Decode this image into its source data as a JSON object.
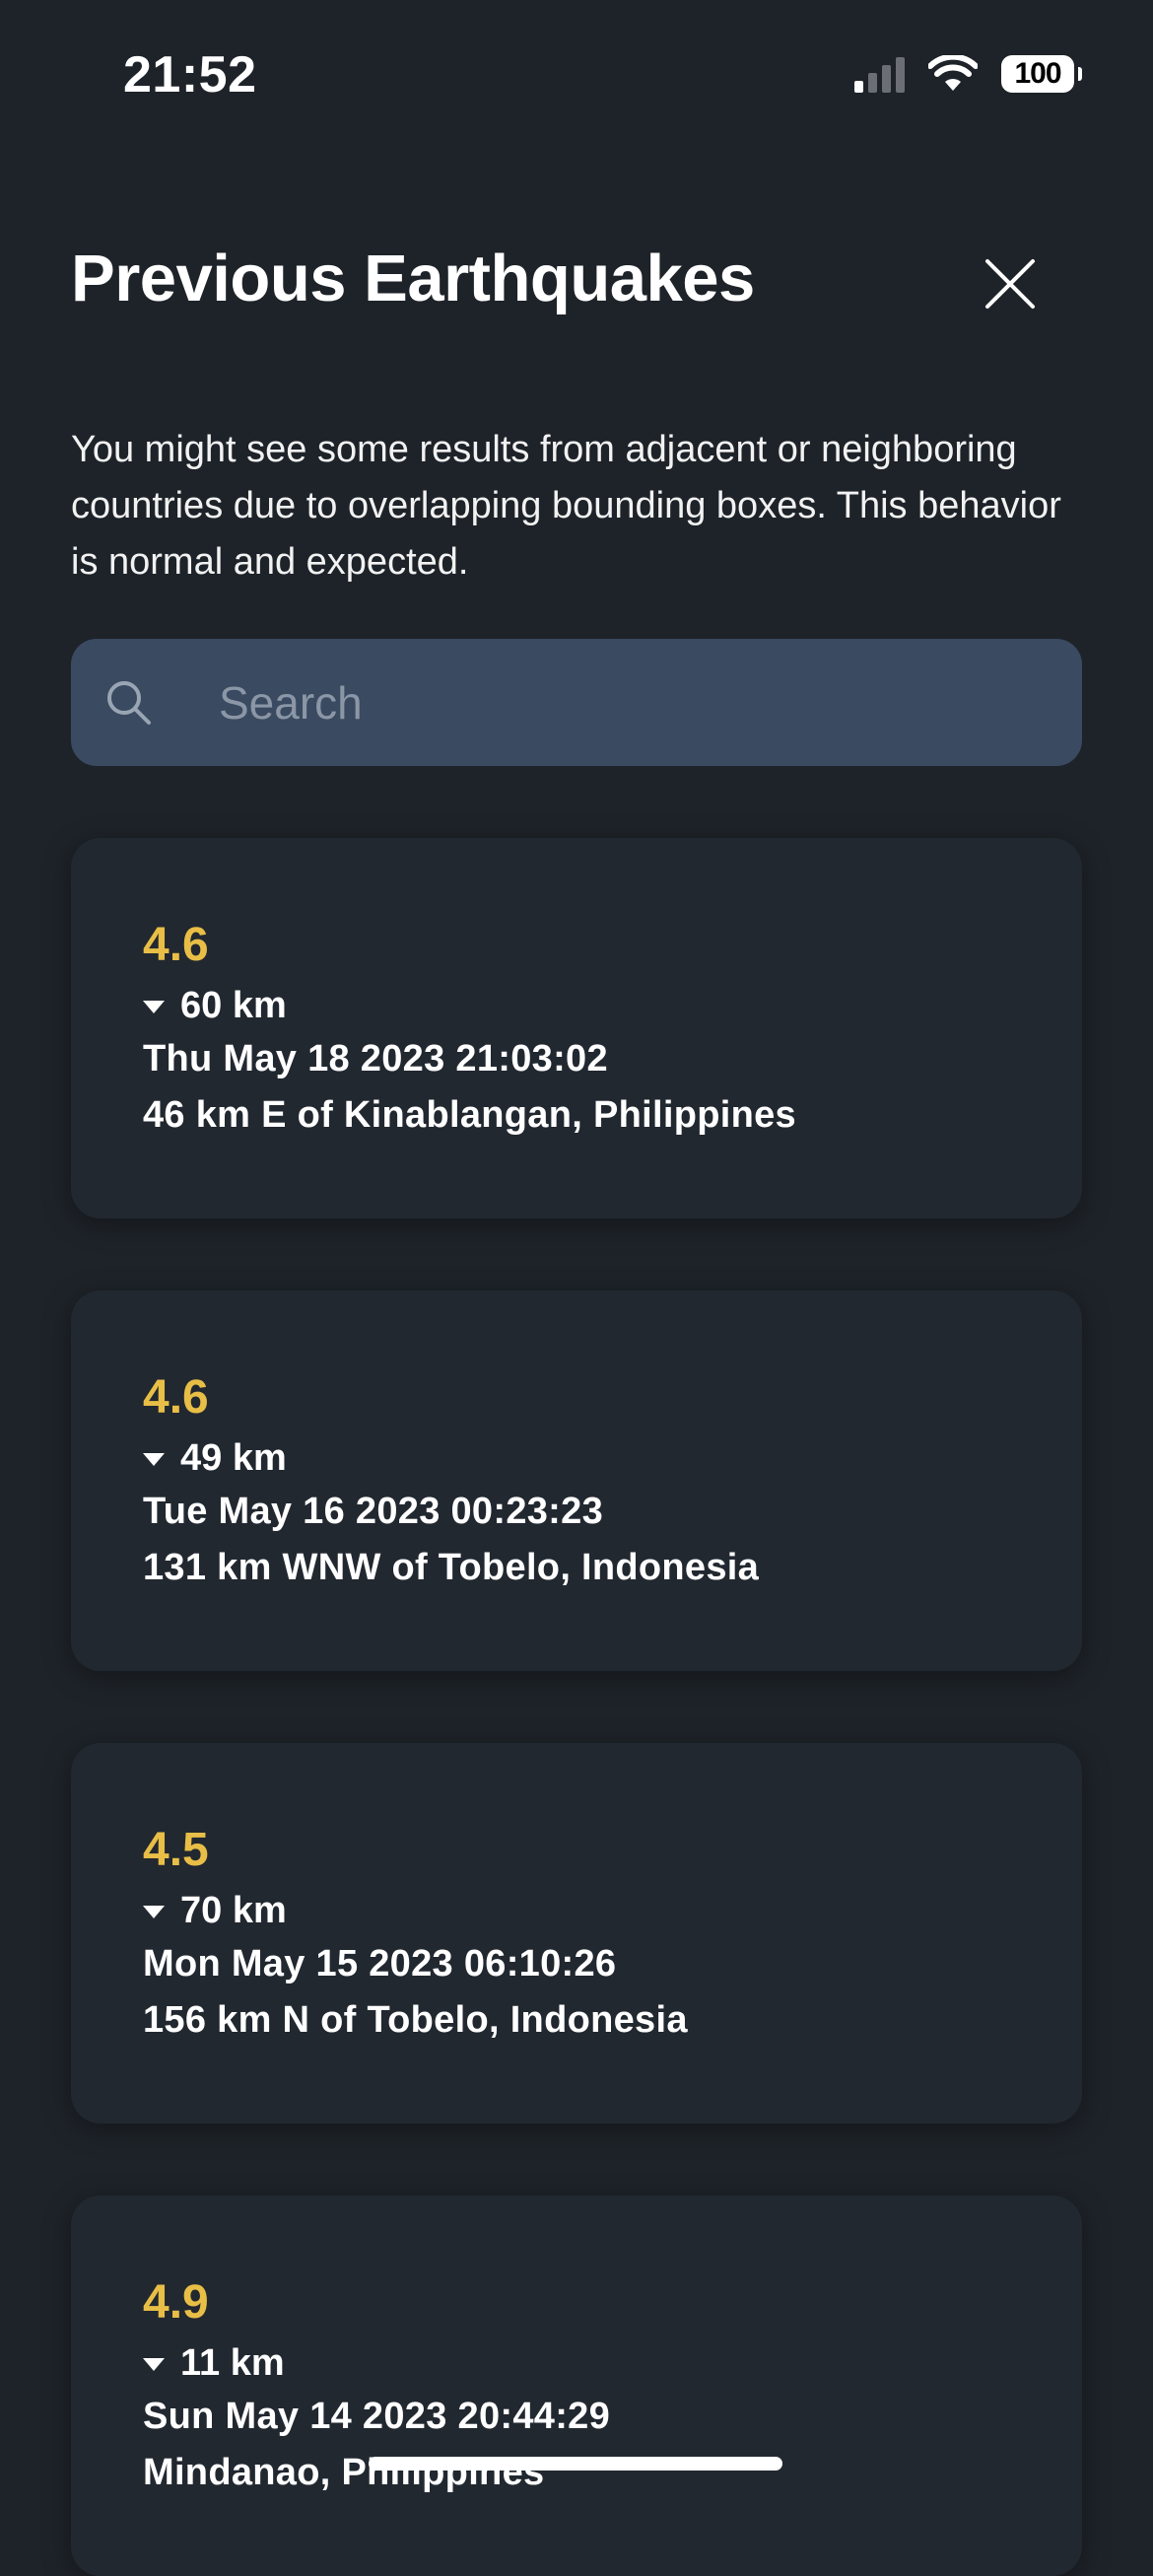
{
  "status_bar": {
    "time": "21:52",
    "battery": "100",
    "signal_bars_active": 1,
    "signal_bars_total": 4
  },
  "header": {
    "title": "Previous Earthquakes",
    "close_icon": "close-icon"
  },
  "description": "You might see some results from adjacent or neighboring countries due to overlapping bounding boxes. This behavior is normal and expected.",
  "search": {
    "placeholder": "Search",
    "value": "",
    "icon": "search-icon"
  },
  "colors": {
    "background": "#1e2329",
    "card": "#222830",
    "search_bg": "#3a4a61",
    "magnitude": "#e8be46",
    "text": "#ffffff"
  },
  "quakes": [
    {
      "magnitude": "4.6",
      "depth": "60 km",
      "datetime": "Thu May 18 2023 21:03:02",
      "location": "46 km E of Kinablangan, Philippines"
    },
    {
      "magnitude": "4.6",
      "depth": "49 km",
      "datetime": "Tue May 16 2023 00:23:23",
      "location": "131 km WNW of Tobelo, Indonesia"
    },
    {
      "magnitude": "4.5",
      "depth": "70 km",
      "datetime": "Mon May 15 2023 06:10:26",
      "location": "156 km N of Tobelo, Indonesia"
    },
    {
      "magnitude": "4.9",
      "depth": "11 km",
      "datetime": "Sun May 14 2023 20:44:29",
      "location": "Mindanao, Philippines"
    }
  ]
}
